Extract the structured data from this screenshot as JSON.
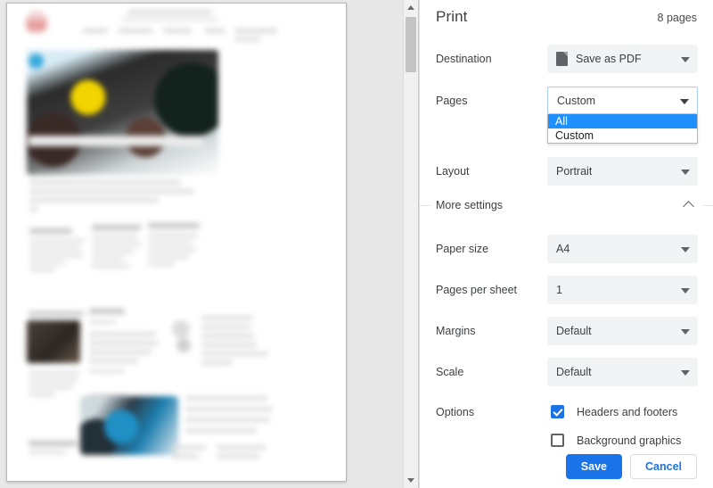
{
  "header": {
    "title": "Print",
    "page_count": "8 pages"
  },
  "settings": {
    "destination": {
      "label": "Destination",
      "value": "Save as PDF",
      "icon": "pdf-document-icon"
    },
    "pages": {
      "label": "Pages",
      "value": "Custom",
      "expanded": true,
      "options": [
        {
          "label": "All",
          "selected": true
        },
        {
          "label": "Custom",
          "selected": false
        }
      ]
    },
    "layout": {
      "label": "Layout",
      "value": "Portrait"
    },
    "more_settings": {
      "label": "More settings",
      "expanded": true,
      "icon": "chevron-up-icon"
    },
    "paper_size": {
      "label": "Paper size",
      "value": "A4"
    },
    "pages_per_sheet": {
      "label": "Pages per sheet",
      "value": "1"
    },
    "margins": {
      "label": "Margins",
      "value": "Default"
    },
    "scale": {
      "label": "Scale",
      "value": "Default"
    },
    "options": {
      "label": "Options",
      "headers_and_footers": {
        "label": "Headers and footers",
        "checked": true
      },
      "background_graphics": {
        "label": "Background graphics",
        "checked": false
      }
    }
  },
  "actions": {
    "save_label": "Save",
    "cancel_label": "Cancel"
  },
  "preview": {
    "scrollbar": {
      "up_icon": "scroll-up-arrow-icon",
      "down_icon": "scroll-down-arrow-icon"
    }
  },
  "colors": {
    "accent": "#1a73e8",
    "highlight": "#1e90ff",
    "text": "#3c4043",
    "control_bg": "#f1f3f4",
    "focus_border": "#a7cdf5"
  }
}
